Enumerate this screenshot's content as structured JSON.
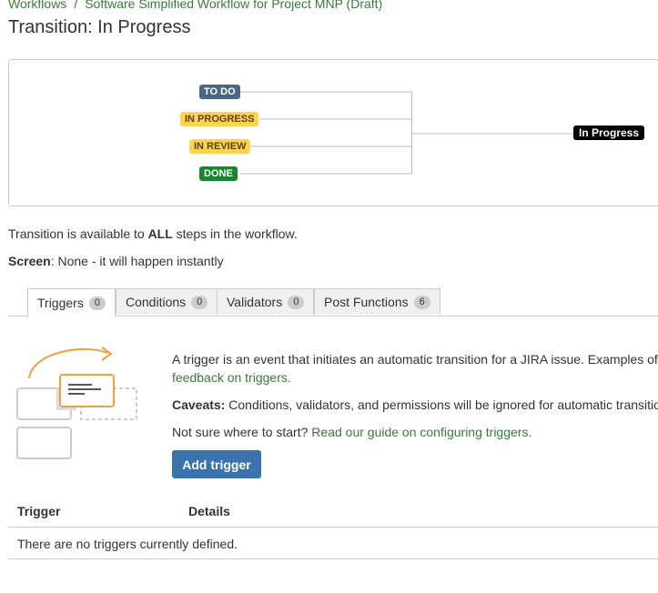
{
  "breadcrumb": {
    "items": [
      "Workflows",
      "Software Simplified Workflow for Project MNP (Draft)"
    ],
    "separator": "/"
  },
  "page_title": "Transition: In Progress",
  "diagram": {
    "source_statuses": [
      {
        "label": "TO DO",
        "category": "todo",
        "color": "#4a6785"
      },
      {
        "label": "IN PROGRESS",
        "category": "in-progress",
        "color": "#ffd351"
      },
      {
        "label": "IN REVIEW",
        "category": "in-progress",
        "color": "#ffd351"
      },
      {
        "label": "DONE",
        "category": "done",
        "color": "#14892c"
      }
    ],
    "transition_label": "In Progress"
  },
  "availability": {
    "prefix": "Transition is available to ",
    "emphasis": "ALL",
    "suffix": " steps in the workflow."
  },
  "screen": {
    "label": "Screen",
    "value": ": None - it will happen instantly"
  },
  "tabs": [
    {
      "label": "Triggers",
      "count": "0",
      "active": true
    },
    {
      "label": "Conditions",
      "count": "0",
      "active": false
    },
    {
      "label": "Validators",
      "count": "0",
      "active": false
    },
    {
      "label": "Post Functions",
      "count": "6",
      "active": false
    }
  ],
  "triggers": {
    "intro_text": "A trigger is an event that initiates an automatic transition for a JIRA issue. Examples of",
    "intro_link": "feedback on triggers.",
    "caveats_label": "Caveats:",
    "caveats_text": " Conditions, validators, and permissions will be ignored for automatic transitio",
    "guide_prefix": "Not sure where to start? ",
    "guide_link": "Read our guide on configuring triggers.",
    "add_button": "Add trigger",
    "table": {
      "columns": [
        "Trigger",
        "Details"
      ],
      "empty_message": "There are no triggers currently defined."
    }
  },
  "colors": {
    "link": "#3b7a3b",
    "primary_button": "#3b73af",
    "illustration_accent": "#f0a040"
  }
}
